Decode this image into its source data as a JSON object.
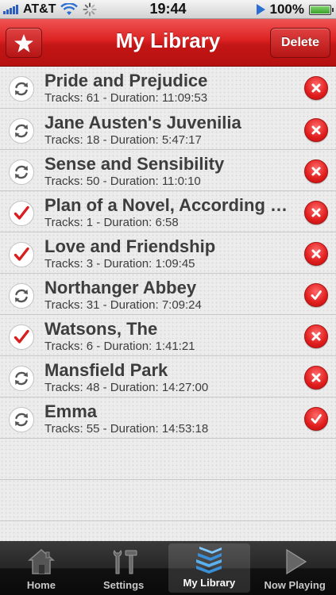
{
  "status_bar": {
    "carrier": "AT&T",
    "time": "19:44",
    "battery": "100%",
    "battery_level": 1.0
  },
  "nav": {
    "title": "My Library",
    "delete_label": "Delete",
    "star_icon": "star-icon"
  },
  "books": [
    {
      "title": "Pride and Prejudice",
      "meta": "Tracks: 61 - Duration: 11:09:53",
      "status": "sync",
      "action": "delete"
    },
    {
      "title": "Jane Austen's Juvenilia",
      "meta": "Tracks: 18 - Duration: 5:47:17",
      "status": "sync",
      "action": "delete"
    },
    {
      "title": "Sense and Sensibility",
      "meta": "Tracks: 50 - Duration: 11:0:10",
      "status": "sync",
      "action": "delete"
    },
    {
      "title": "Plan of a Novel, According to Hints from Various Quarters",
      "meta": "Tracks: 1 - Duration: 6:58",
      "status": "check",
      "action": "delete"
    },
    {
      "title": "Love and Friendship",
      "meta": "Tracks: 3 - Duration: 1:09:45",
      "status": "check",
      "action": "delete"
    },
    {
      "title": "Northanger Abbey",
      "meta": "Tracks: 31 - Duration: 7:09:24",
      "status": "sync",
      "action": "done"
    },
    {
      "title": "Watsons, The",
      "meta": "Tracks: 6 - Duration: 1:41:21",
      "status": "check",
      "action": "delete"
    },
    {
      "title": "Mansfield Park",
      "meta": "Tracks: 48 - Duration: 14:27:00",
      "status": "sync",
      "action": "delete"
    },
    {
      "title": "Emma",
      "meta": "Tracks: 55 - Duration: 14:53:18",
      "status": "sync",
      "action": "done"
    }
  ],
  "tabs": [
    {
      "label": "Home",
      "icon": "home-icon",
      "active": false
    },
    {
      "label": "Settings",
      "icon": "tools-icon",
      "active": false
    },
    {
      "label": "My Library",
      "icon": "books-icon",
      "active": true
    },
    {
      "label": "Now Playing",
      "icon": "play-icon",
      "active": false
    }
  ],
  "colors": {
    "accent_red": "#dc2222",
    "text_dark": "#3d3d3d",
    "check_red": "#d81e1e"
  }
}
